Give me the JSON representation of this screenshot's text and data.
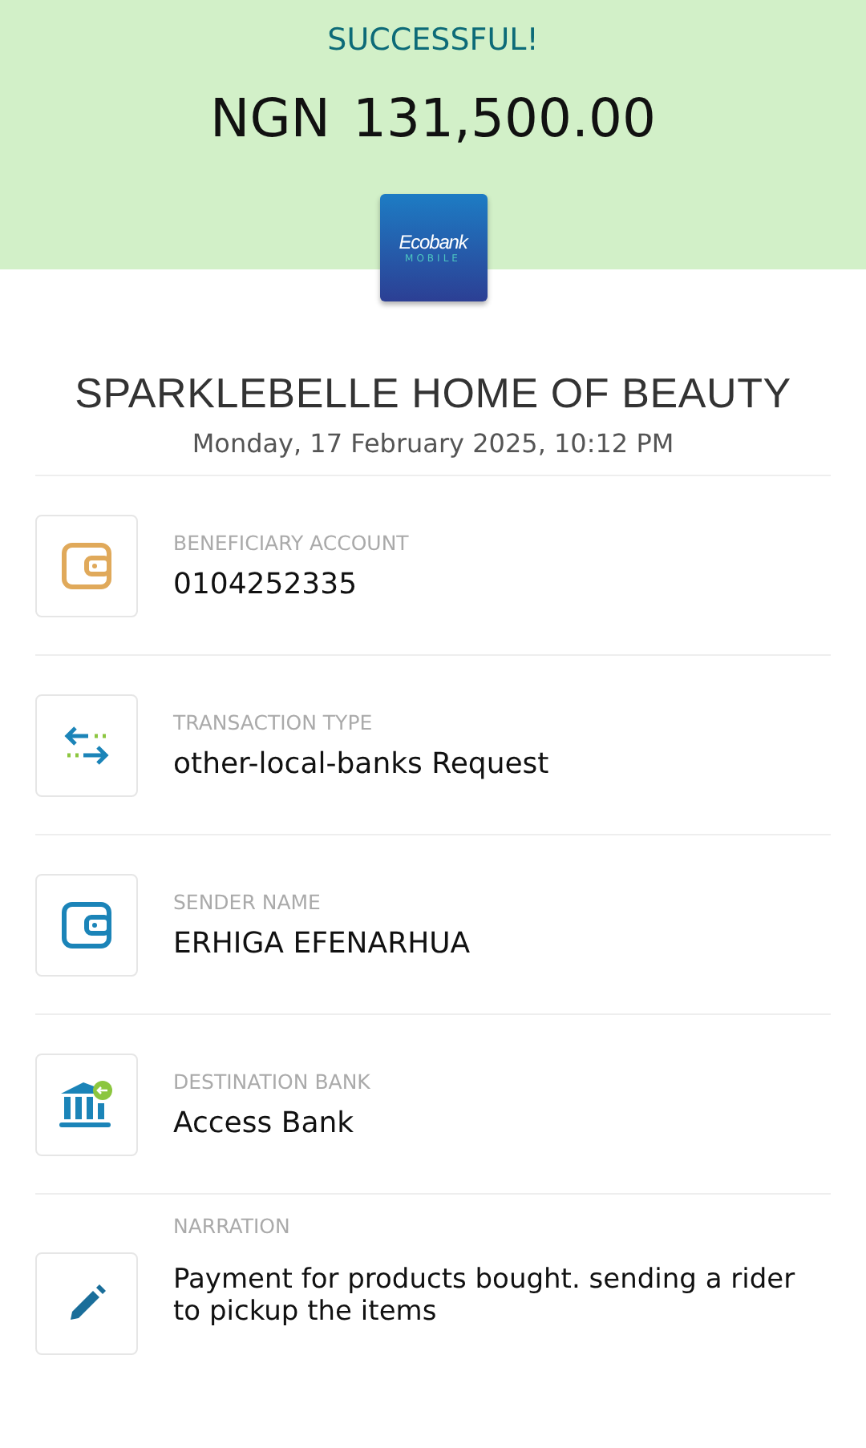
{
  "status": "SUCCESSFUL!",
  "amount": {
    "currency": "NGN",
    "value": "131,500.00"
  },
  "logo": {
    "name": "Ecobank",
    "subtitle": "MOBILE"
  },
  "beneficiary": "SPARKLEBELLE HOME OF BEAUTY",
  "date": "Monday, 17 February 2025, 10:12 PM",
  "details": [
    {
      "kind": "wallet",
      "color": "#e0a95a",
      "label": "BENEFICIARY ACCOUNT",
      "value": "0104252335"
    },
    {
      "kind": "transfer",
      "label": "TRANSACTION TYPE",
      "value": "other-local-banks Request"
    },
    {
      "kind": "wallet",
      "color": "#1b84b8",
      "label": "SENDER NAME",
      "value": "ERHIGA EFENARHUA"
    },
    {
      "kind": "bank",
      "label": "DESTINATION BANK",
      "value": "Access Bank"
    },
    {
      "kind": "pencil",
      "label": "NARRATION",
      "value": "Payment for products bought. sending a rider to pickup the items"
    }
  ]
}
